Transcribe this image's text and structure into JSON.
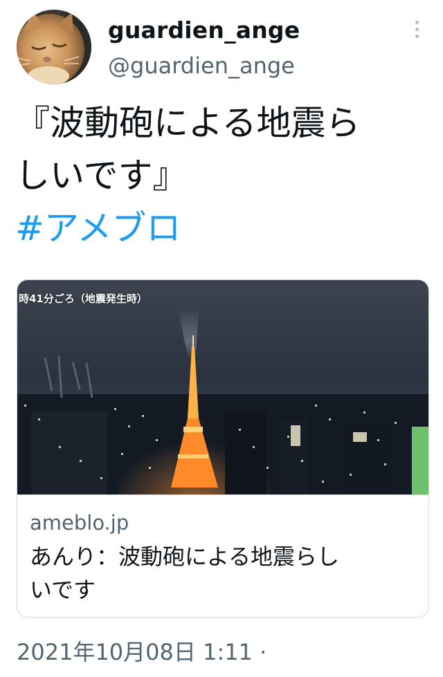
{
  "user": {
    "display_name": "guardien_ange",
    "handle": "@guardien_ange"
  },
  "tweet": {
    "text_line1": "『波動砲による地震ら",
    "text_line2": "しいです』",
    "hashtag": "#アメブロ"
  },
  "card": {
    "image_caption": "時41分ごろ（地震発生時）",
    "domain": "ameblo.jp",
    "title_line1": "あんり：波動砲による地震らし",
    "title_line2": "いです"
  },
  "meta": {
    "timestamp": "2021年10月08日 1:11 ·"
  },
  "icons": {
    "more": "more-vertical-icon"
  },
  "colors": {
    "text": "#0f1419",
    "secondary": "#536471",
    "link": "#1d9bf0",
    "border": "#cfd9de"
  }
}
